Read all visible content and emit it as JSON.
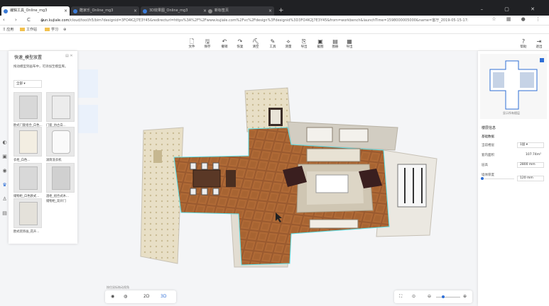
{
  "browser": {
    "tabs": [
      {
        "label": "编辑工具_Online_mg3",
        "active": true
      },
      {
        "label": "酷家乐_Online_mg3",
        "active": false
      },
      {
        "label": "3D效果图_Online_mg3",
        "active": false
      },
      {
        "label": "新标签页",
        "active": false
      }
    ],
    "window_controls": "–  ▢  ✕",
    "nav_icons": "‹ › C ⌂",
    "url_host": "yun.kujiale.com",
    "url_rest": "/cloud/tool/h5/bim?designid=3FO4K2J7E3Y45&redirecturl=https%3A%2F%2Fwww.kujiale.com%2Fvc%2Fdesign%3Fdesignid%3D3FO4K2J7E3Y45&from=workbench&launchTime=1598000005000&name=客厅_2019-05-15-17:",
    "addr_right_icons": "☆ ▦ ● ⋮",
    "bookmarks": [
      "应用",
      "工作站",
      "学习"
    ],
    "bookmark_extra": "⊕"
  },
  "toolbar": {
    "items": [
      {
        "icon": "🗋",
        "label": "文件"
      },
      {
        "icon": "🖫",
        "label": "保存"
      },
      {
        "icon": "↶",
        "label": "撤销"
      },
      {
        "icon": "↷",
        "label": "恢复"
      },
      {
        "icon": "⛏",
        "label": "清空"
      },
      {
        "icon": "✎",
        "label": "工具"
      },
      {
        "icon": "⟡",
        "label": "测量"
      },
      {
        "icon": "⎘",
        "label": "导出"
      },
      {
        "icon": "▣",
        "label": "截图"
      },
      {
        "icon": "▤",
        "label": "图册"
      },
      {
        "icon": "▦",
        "label": "导出"
      }
    ],
    "right_items": [
      {
        "icon": "?",
        "label": "帮助"
      },
      {
        "icon": "⇥",
        "label": "退出"
      }
    ]
  },
  "left_rail": [
    "◐",
    "▣",
    "◉",
    "♛",
    "♙",
    "▤"
  ],
  "catalog_panel": {
    "title": "快速_模型放置",
    "controls": "▤ ✕",
    "hint": "拖动模型到画布中，可添加至模型库。",
    "filter": "全部 ▾",
    "items": [
      {
        "label": "欧式门套组合_白色..."
      },
      {
        "label": "门套_仿古白..."
      },
      {
        "label": "衣柜_白色..."
      },
      {
        "label": "滚筒洗衣机"
      },
      {
        "label": "储物柜_白色欧式..."
      },
      {
        "label": "酒柜_组合式木..."
      },
      {
        "label": "双门储物柜_欧式"
      },
      {
        "label": "储物柜_双开门"
      },
      {
        "label": "欧式装饰画_花卉..."
      }
    ]
  },
  "properties_panel": {
    "minimap_label": "显示所有楼层",
    "section_title": "楼层信息",
    "subsection": "基础数据",
    "rows": [
      {
        "label": "当前楼层",
        "value": "1层 ▾"
      },
      {
        "label": "套内面积",
        "value": "107.74m²"
      },
      {
        "label": "层高",
        "value": "2800 mm"
      },
      {
        "label": "墙体厚度",
        "value": "120 mm"
      }
    ]
  },
  "view_controls": {
    "left": [
      "◉",
      "◍",
      "2D",
      "3D"
    ],
    "active": "3D",
    "right": [
      "⛶",
      "⊙",
      "⊖",
      "⊕"
    ],
    "scale_hint": "按住鼠标拖动视角"
  },
  "colors": {
    "floor": "#9a5a2f",
    "wall": "#d9d3c8",
    "wallpaper": "#e6dcc2",
    "rug": "#cfc6b3",
    "accent": "#2f6fd6",
    "outline": "#5ee0e8"
  }
}
